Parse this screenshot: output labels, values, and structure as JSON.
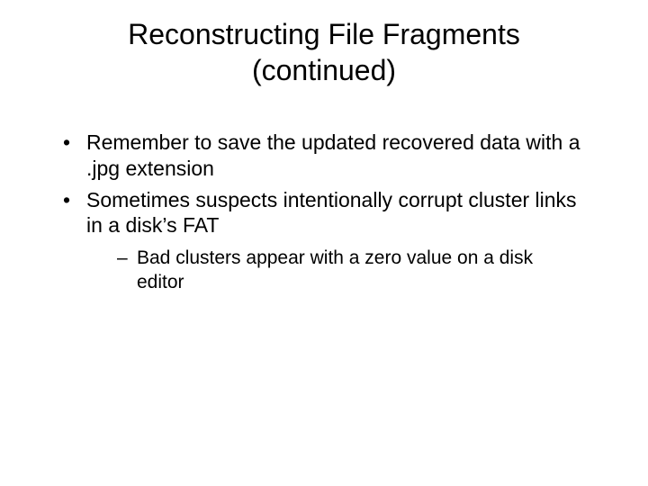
{
  "title_line1": "Reconstructing File Fragments",
  "title_line2": "(continued)",
  "bullets": {
    "0": "Remember to save the updated recovered data with a .jpg extension",
    "1": "Sometimes suspects intentionally corrupt cluster links in a disk’s FAT",
    "1_sub": {
      "0": "Bad clusters appear with a zero value on a disk editor"
    }
  }
}
